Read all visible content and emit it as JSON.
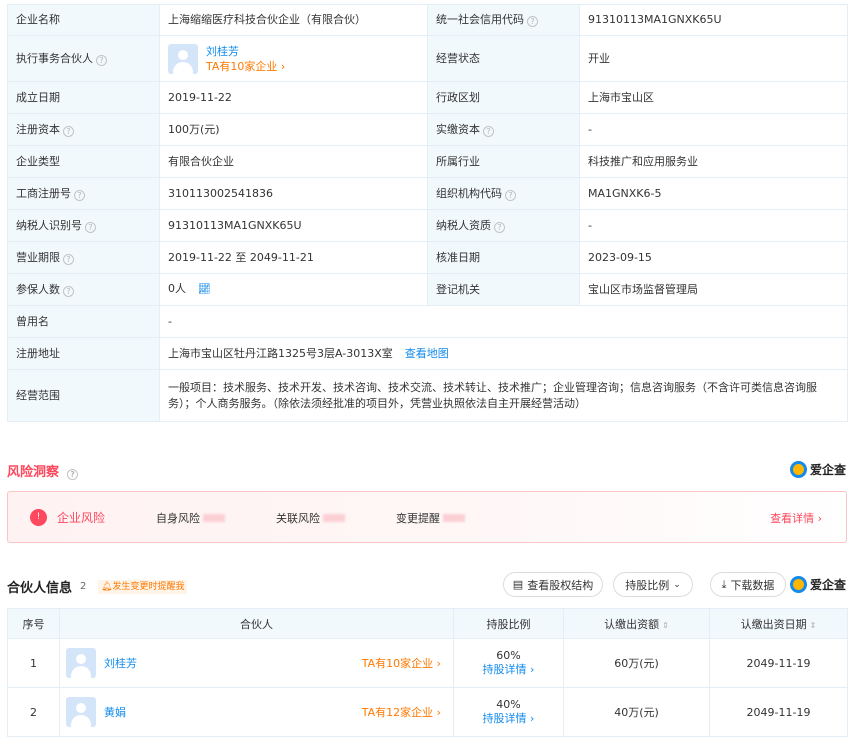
{
  "basic": {
    "company_name_label": "企业名称",
    "company_name": "上海缩缩医疗科技合伙企业（有限合伙）",
    "credit_code_label": "统一社会信用代码",
    "credit_code": "91310113MA1GNXK65U",
    "executive_partner_label": "执行事务合伙人",
    "executive_partner_name": "刘桂芳",
    "executive_partner_ta": "TA有10家企业 ›",
    "status_label": "经营状态",
    "status": "开业",
    "established_label": "成立日期",
    "established": "2019-11-22",
    "district_label": "行政区划",
    "district": "上海市宝山区",
    "reg_capital_label": "注册资本",
    "reg_capital": "100万(元)",
    "paid_capital_label": "实缴资本",
    "paid_capital": "-",
    "company_type_label": "企业类型",
    "company_type": "有限合伙企业",
    "industry_label": "所属行业",
    "industry": "科技推广和应用服务业",
    "biz_reg_no_label": "工商注册号",
    "biz_reg_no": "310113002541836",
    "org_code_label": "组织机构代码",
    "org_code": "MA1GNXK6-5",
    "taxpayer_id_label": "纳税人识别号",
    "taxpayer_id": "91310113MA1GNXK65U",
    "taxpayer_qual_label": "纳税人资质",
    "taxpayer_qual": "-",
    "term_label": "营业期限",
    "term": "2019-11-22 至 2049-11-21",
    "approved_label": "核准日期",
    "approved": "2023-09-15",
    "insured_label": "参保人数",
    "insured": "0人",
    "authority_label": "登记机关",
    "authority": "宝山区市场监督管理局",
    "former_name_label": "曾用名",
    "former_name": "-",
    "address_label": "注册地址",
    "address": "上海市宝山区牡丹江路1325号3层A-3013X室",
    "view_map": "查看地图",
    "scope_label": "经营范围",
    "scope": "一般项目：技术服务、技术开发、技术咨询、技术交流、技术转让、技术推广；企业管理咨询；信息咨询服务（不含许可类信息咨询服务）；个人商务服务。（除依法须经批准的项目外，凭营业执照依法自主开展经营活动）"
  },
  "risk": {
    "title": "风险洞察",
    "brand": "爱企查",
    "name": "企业风险",
    "items": [
      "自身风险",
      "关联风险",
      "变更提醒"
    ],
    "more": "查看详情 ›"
  },
  "partners": {
    "title": "合伙人信息",
    "count": "2",
    "notify": "发生变更时提醒我",
    "btn_structure": "查看股权结构",
    "btn_ratio": "持股比例",
    "btn_download": "下载数据",
    "brand": "爱企查",
    "headers": [
      "序号",
      "合伙人",
      "持股比例",
      "认缴出资额",
      "认缴出资日期"
    ],
    "rows": [
      {
        "no": "1",
        "name": "刘桂芳",
        "ta": "TA有10家企业 ›",
        "pct": "60%",
        "detail": "持股详情 ›",
        "amount": "60万(元)",
        "date": "2049-11-19"
      },
      {
        "no": "2",
        "name": "黄娟",
        "ta": "TA有12家企业 ›",
        "pct": "40%",
        "detail": "持股详情 ›",
        "amount": "40万(元)",
        "date": "2049-11-19"
      }
    ]
  }
}
